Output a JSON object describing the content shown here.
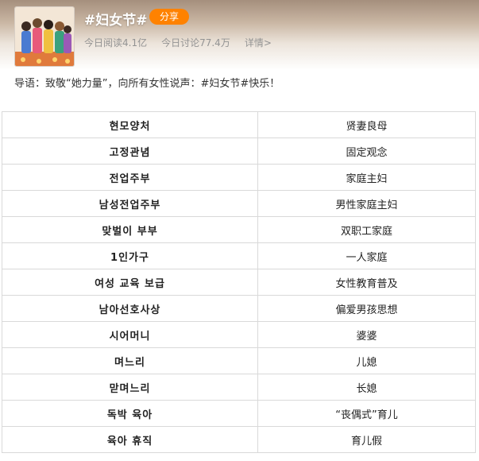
{
  "topic": {
    "title": "#妇女节#",
    "share_label": "分享",
    "reads": "今日阅读4.1亿",
    "discussions": "今日讨论77.4万",
    "details_link": "详情>"
  },
  "intro": "导语：致敬“她力量”，向所有女性说声：#妇女节#快乐！",
  "table": {
    "rows": [
      {
        "ko": "현모양처",
        "zh": "贤妻良母"
      },
      {
        "ko": "고정관념",
        "zh": "固定观念"
      },
      {
        "ko": "전업주부",
        "zh": "家庭主妇"
      },
      {
        "ko": "남성전업주부",
        "zh": "男性家庭主妇"
      },
      {
        "ko": "맞벌이 부부",
        "zh": "双职工家庭"
      },
      {
        "ko": "1인가구",
        "zh": "一人家庭"
      },
      {
        "ko": "여성 교육 보급",
        "zh": "女性教育普及"
      },
      {
        "ko": "남아선호사상",
        "zh": "偏爱男孩思想"
      },
      {
        "ko": "시어머니",
        "zh": "婆婆"
      },
      {
        "ko": "며느리",
        "zh": "儿媳"
      },
      {
        "ko": "맏며느리",
        "zh": "长媳"
      },
      {
        "ko": "독박 육아",
        "zh": "“丧偶式”育儿"
      },
      {
        "ko": "육아 휴직",
        "zh": "育儿假"
      }
    ]
  }
}
